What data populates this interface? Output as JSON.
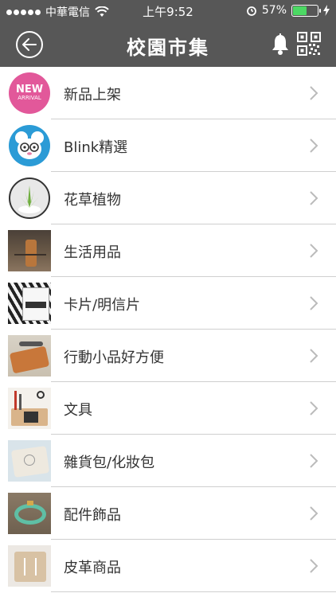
{
  "status": {
    "carrier": "中華電信",
    "time": "上午9:52",
    "battery": "57%",
    "battery_level": 0.57,
    "battery_color": "#4cd964"
  },
  "nav": {
    "title": "校園市集",
    "back_icon": "back-circle-icon",
    "bell_icon": "bell-icon",
    "qr_icon": "qr-code-icon",
    "bar_color": "#575757"
  },
  "new_badge": {
    "line1": "NEW",
    "line2": "ARRIVAL",
    "color": "#e2589a"
  },
  "categories": [
    {
      "label": "新品上架"
    },
    {
      "label": "Blink精選"
    },
    {
      "label": "花草植物"
    },
    {
      "label": "生活用品"
    },
    {
      "label": "卡片/明信片"
    },
    {
      "label": "行動小品好方便"
    },
    {
      "label": "文具"
    },
    {
      "label": "雜貨包/化妝包"
    },
    {
      "label": "配件飾品"
    },
    {
      "label": "皮革商品"
    }
  ]
}
